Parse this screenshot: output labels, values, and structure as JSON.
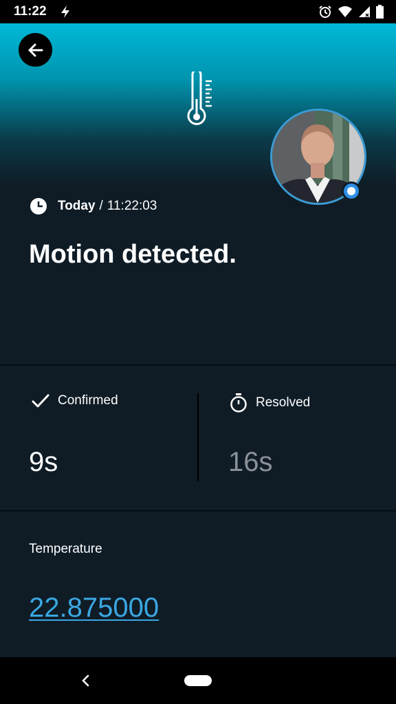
{
  "status_bar": {
    "time": "11:22",
    "icons": [
      "bolt-icon",
      "alarm-icon",
      "wifi-icon",
      "signal-icon",
      "battery-icon"
    ]
  },
  "header": {
    "back_icon": "arrow-left-icon",
    "device_icon": "thermometer-icon"
  },
  "event": {
    "day": "Today",
    "separator": "/",
    "time": "11:22:03",
    "title": "Motion detected."
  },
  "stats": {
    "confirmed": {
      "label": "Confirmed",
      "value": "9s",
      "icon": "check-icon"
    },
    "resolved": {
      "label": "Resolved",
      "value": "16s",
      "icon": "stopwatch-icon"
    }
  },
  "temperature": {
    "label": "Temperature",
    "value": "22.875000"
  },
  "colors": {
    "background": "#0f1c26",
    "accent": "#3ba7e3",
    "hero_top": "#00b9d8",
    "muted_value": "#8a9198"
  }
}
